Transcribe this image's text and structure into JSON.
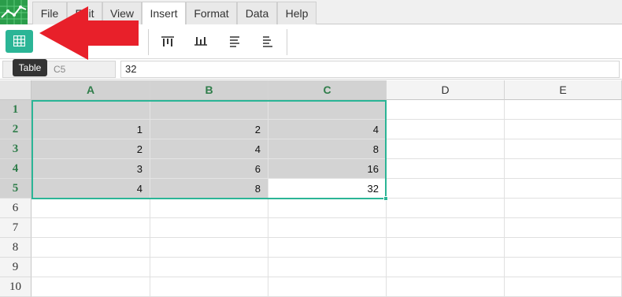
{
  "menu": {
    "items": [
      {
        "label": "File"
      },
      {
        "label": "Edit"
      },
      {
        "label": "View"
      },
      {
        "label": "Insert"
      },
      {
        "label": "Format"
      },
      {
        "label": "Data"
      },
      {
        "label": "Help"
      }
    ],
    "active": "Insert"
  },
  "toolbar": {
    "table_button_icon": "table-icon",
    "tooltip": "Table",
    "icons": [
      "align-top-icon",
      "align-middle-icon",
      "align-bottom-icon",
      "align-bottom-alt-icon"
    ]
  },
  "formula_bar": {
    "cell_ref": "C5",
    "value": "32"
  },
  "sheet": {
    "columns": [
      "A",
      "B",
      "C",
      "D",
      "E"
    ],
    "rows": [
      "1",
      "2",
      "3",
      "4",
      "5",
      "6",
      "7",
      "8",
      "9",
      "10"
    ],
    "cells": [
      [
        "",
        "",
        ""
      ],
      [
        "1",
        "2",
        "4"
      ],
      [
        "2",
        "4",
        "8"
      ],
      [
        "3",
        "6",
        "16"
      ],
      [
        "4",
        "8",
        "32"
      ]
    ],
    "selection": "A1:C5",
    "active_cell": "C5"
  },
  "colors": {
    "accent": "#2bb596",
    "selected_header_text": "#2f7d4a",
    "arrow": "#e8202a"
  }
}
